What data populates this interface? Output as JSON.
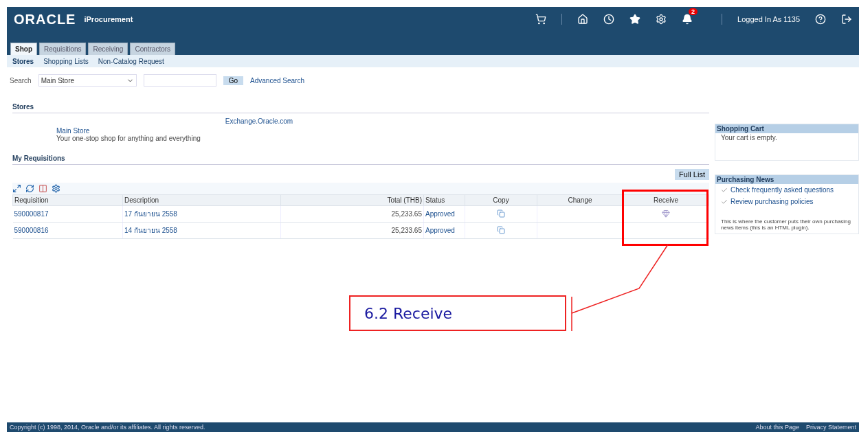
{
  "header": {
    "logo": "ORACLE",
    "product": "iProcurement",
    "notification_count": "2",
    "user": "Logged In As 1135"
  },
  "tabs": [
    {
      "label": "Shop",
      "selected": true
    },
    {
      "label": "Requisitions",
      "selected": false
    },
    {
      "label": "Receiving",
      "selected": false
    },
    {
      "label": "Contractors",
      "selected": false
    }
  ],
  "subtabs": [
    {
      "label": "Stores",
      "selected": true
    },
    {
      "label": "Shopping Lists",
      "selected": false
    },
    {
      "label": "Non-Catalog Request",
      "selected": false
    }
  ],
  "search": {
    "label": "Search",
    "store": "Main Store",
    "button": "Go",
    "link": "Advanced Search"
  },
  "stores": {
    "title": "Stores",
    "items": [
      {
        "name": "Main Store",
        "description": "Your one-stop shop for anything and everything"
      }
    ],
    "exchange": "Exchange.Oracle.com"
  },
  "requisitions": {
    "title": "My Requisitions",
    "full_list": "Full List",
    "columns": [
      "Requisition",
      "Description",
      "Total (THB)",
      "Status",
      "Copy",
      "Change",
      "Receive"
    ],
    "rows": [
      {
        "requisition": "590000817",
        "description": "17 กันยายน 2558",
        "total": "25,233.65",
        "status": "Approved",
        "receivable": true
      },
      {
        "requisition": "590000816",
        "description": "14 กันยายน 2558",
        "total": "25,233.65",
        "status": "Approved",
        "receivable": false
      }
    ]
  },
  "sidebar": {
    "cart_title": "Shopping Cart",
    "cart_text": "Your cart is empty.",
    "news_title": "Purchasing News",
    "news_links": [
      "Check frequently asked questions",
      "Review purchasing policies"
    ],
    "news_note": "This is where the customer puts their own purchasing news items (this is an HTML plugin)."
  },
  "footer": {
    "copyright": "Copyright (c) 1998, 2014, Oracle and/or its affiliates. All rights reserved.",
    "links": [
      "About this Page",
      "Privacy Statement"
    ]
  },
  "annotation": {
    "label": "6.2 Receive"
  }
}
